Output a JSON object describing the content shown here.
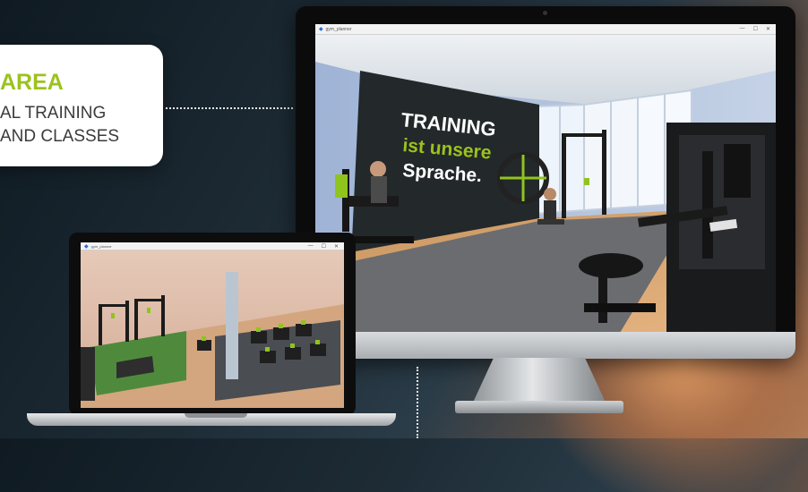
{
  "callout": {
    "heading": "AREA",
    "line1": "AL TRAINING",
    "line2": "AND CLASSES"
  },
  "monitor": {
    "window_title": "gym_planner",
    "controls": [
      "—",
      "☐",
      "✕"
    ],
    "wall_text": [
      "TRAINING",
      "ist unsere",
      "Sprache."
    ]
  },
  "laptop": {
    "window_title": "gym_planner",
    "controls": [
      "—",
      "☐",
      "✕"
    ]
  },
  "colors": {
    "accent_green": "#9cc21c",
    "banner_dark": "#23282b",
    "monitor_bezel": "#0b0b0c"
  }
}
